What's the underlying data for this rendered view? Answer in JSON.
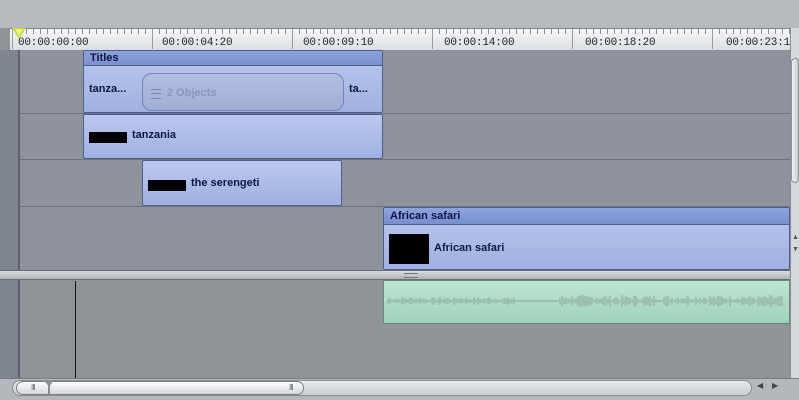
{
  "ruler": {
    "timecodes": [
      "00:00:00:00",
      "00:00:04:20",
      "00:00:09:10",
      "00:00:14:00",
      "00:00:18:20",
      "00:00:23:1"
    ]
  },
  "tracks": {
    "titles_group": {
      "header": "Titles",
      "left_label": "tanza...",
      "group_label": "2 Objects",
      "right_label": "ta..."
    },
    "clip_tanzania": {
      "label": "tanzania"
    },
    "clip_serengeti": {
      "label": "the serengeti"
    },
    "clip_african_safari": {
      "header": "African safari",
      "label": "African safari"
    }
  },
  "colors": {
    "clip_blue": "#a9b8e7",
    "clip_header_blue": "#8497d4",
    "audio_green": "#a9d8c1",
    "playhead_yellow": "#c9d64a"
  },
  "icons": [
    "playhead-icon",
    "group-list-icon",
    "scroll-left-arrow-icon",
    "scroll-right-arrow-icon",
    "zoom-marker-icon"
  ]
}
